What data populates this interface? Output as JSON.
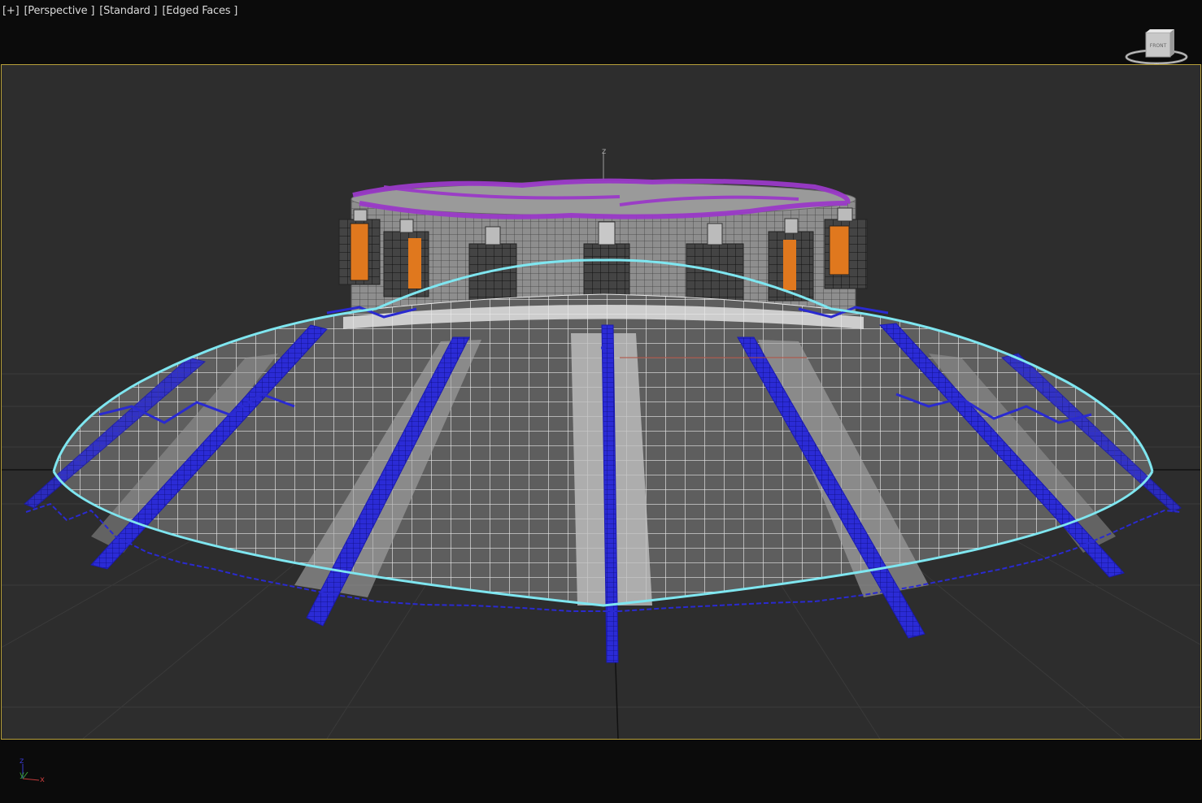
{
  "viewport": {
    "labels": [
      "[+]",
      "[Perspective ]",
      "[Standard ]",
      "[Edged Faces ]"
    ],
    "viewcube_face": "FRONT",
    "world_axis_label": "z"
  },
  "axis_tripod": {
    "z": "z",
    "y": "y",
    "x": "x"
  },
  "icons": {
    "viewcube": "viewcube-icon",
    "axis": "axis-tripod-icon"
  },
  "colors": {
    "viewport_bg": "#2d2d2d",
    "viewport_border": "#b8a03a",
    "selection_outline": "#7fe6f0",
    "wire_blue": "#2a2ad0",
    "accent_purple": "#9a3ac8",
    "accent_orange": "#e0781e"
  }
}
